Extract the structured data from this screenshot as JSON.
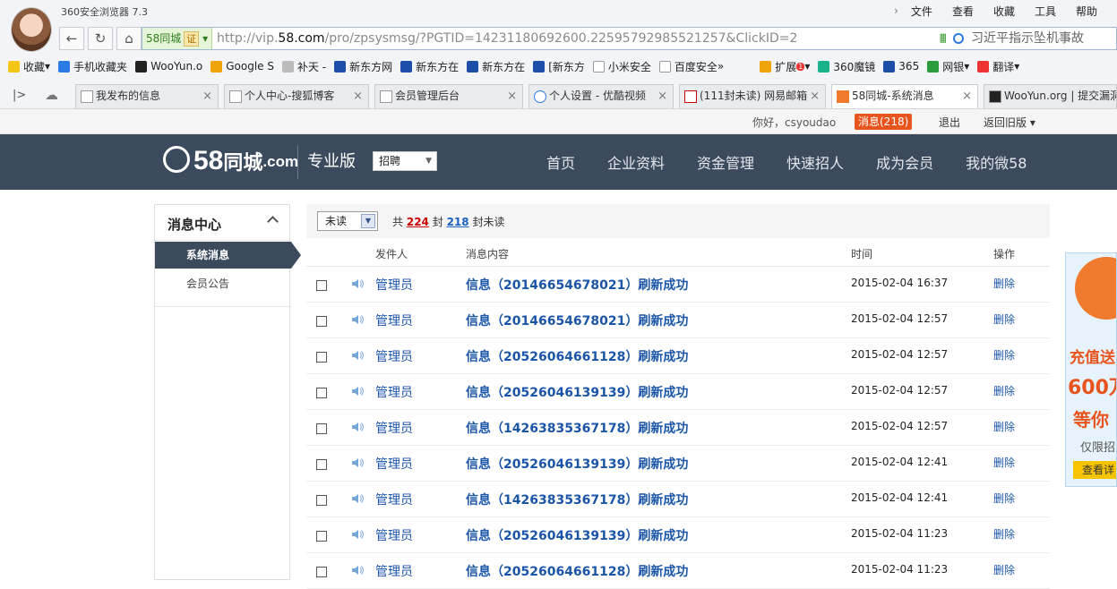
{
  "browser": {
    "title": "360安全浏览器 7.3",
    "menu": [
      "文件",
      "查看",
      "收藏",
      "工具",
      "帮助"
    ],
    "site_badge": "58同城",
    "cert_label": "证",
    "url_prefix": "http://vip.",
    "url_domain": "58.com",
    "url_path": "/pro/zpsysmsg/?PGTID=14231180692600.22595792985521257&ClickID=2",
    "search_text": "习近平指示坠机事故",
    "bookmarks": [
      "收藏",
      "手机收藏夹",
      "WooYun.o",
      "Google S",
      "补天 -",
      "新东方网",
      "新东方在",
      "新东方在",
      "[新东方",
      "小米安全",
      "百度安全"
    ],
    "toolbar_right": [
      "扩展",
      "360魔镜",
      "365",
      "网银",
      "翻译"
    ],
    "extension_count": "1",
    "tabs": [
      "我发布的信息",
      "个人中心-搜狐博客",
      "会员管理后台",
      "个人设置 - 优酷视频",
      "(111封未读) 网易邮箱",
      "58同城-系统消息",
      "WooYun.org | 提交漏洞"
    ]
  },
  "userbar": {
    "greeting": "你好，csyoudao",
    "messages": "消息(218)",
    "logout": "退出",
    "old_version": "返回旧版"
  },
  "header": {
    "logo_text": "58",
    "logo_sub": "同城",
    "logo_com": ".com",
    "pro_label": "专业版",
    "category": "招聘",
    "nav": [
      "首页",
      "企业资料",
      "资金管理",
      "快速招人",
      "成为会员",
      "我的微58"
    ]
  },
  "sidebar": {
    "title": "消息中心",
    "active_item": "系统消息",
    "item2": "会员公告"
  },
  "filter": {
    "selected": "未读",
    "prefix": "共",
    "total": "224",
    "mid": "封",
    "unread": "218",
    "suffix": "封未读"
  },
  "table": {
    "headers": [
      "发件人",
      "消息内容",
      "时间",
      "操作"
    ],
    "rows": [
      {
        "sender": "管理员",
        "content": "信息（20146654678021）刷新成功",
        "time": "2015-02-04 16:37",
        "action": "删除"
      },
      {
        "sender": "管理员",
        "content": "信息（20146654678021）刷新成功",
        "time": "2015-02-04 12:57",
        "action": "删除"
      },
      {
        "sender": "管理员",
        "content": "信息（20526064661128）刷新成功",
        "time": "2015-02-04 12:57",
        "action": "删除"
      },
      {
        "sender": "管理员",
        "content": "信息（20526046139139）刷新成功",
        "time": "2015-02-04 12:57",
        "action": "删除"
      },
      {
        "sender": "管理员",
        "content": "信息（14263835367178）刷新成功",
        "time": "2015-02-04 12:57",
        "action": "删除"
      },
      {
        "sender": "管理员",
        "content": "信息（20526046139139）刷新成功",
        "time": "2015-02-04 12:41",
        "action": "删除"
      },
      {
        "sender": "管理员",
        "content": "信息（14263835367178）刷新成功",
        "time": "2015-02-04 12:41",
        "action": "删除"
      },
      {
        "sender": "管理员",
        "content": "信息（20526046139139）刷新成功",
        "time": "2015-02-04 11:23",
        "action": "删除"
      },
      {
        "sender": "管理员",
        "content": "信息（20526064661128）刷新成功",
        "time": "2015-02-04 11:23",
        "action": "删除"
      }
    ]
  },
  "ad": {
    "line1": "充值送",
    "line2": "600万",
    "line3": "等你",
    "line4": "仅限招",
    "button": "查看详"
  }
}
